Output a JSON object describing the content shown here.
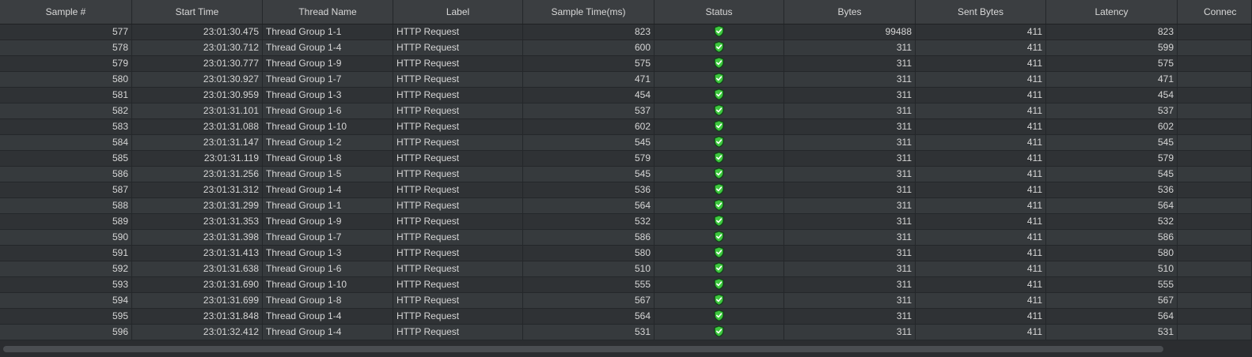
{
  "columns": [
    "Sample #",
    "Start Time",
    "Thread Name",
    "Label",
    "Sample Time(ms)",
    "Status",
    "Bytes",
    "Sent Bytes",
    "Latency",
    "Connec"
  ],
  "rows": [
    {
      "sample": "577",
      "start": "23:01:30.475",
      "thread": "Thread Group 1-1",
      "label": "HTTP Request",
      "time": "823",
      "bytes": "99488",
      "sent": "411",
      "latency": "823"
    },
    {
      "sample": "578",
      "start": "23:01:30.712",
      "thread": "Thread Group 1-4",
      "label": "HTTP Request",
      "time": "600",
      "bytes": "311",
      "sent": "411",
      "latency": "599"
    },
    {
      "sample": "579",
      "start": "23:01:30.777",
      "thread": "Thread Group 1-9",
      "label": "HTTP Request",
      "time": "575",
      "bytes": "311",
      "sent": "411",
      "latency": "575"
    },
    {
      "sample": "580",
      "start": "23:01:30.927",
      "thread": "Thread Group 1-7",
      "label": "HTTP Request",
      "time": "471",
      "bytes": "311",
      "sent": "411",
      "latency": "471"
    },
    {
      "sample": "581",
      "start": "23:01:30.959",
      "thread": "Thread Group 1-3",
      "label": "HTTP Request",
      "time": "454",
      "bytes": "311",
      "sent": "411",
      "latency": "454"
    },
    {
      "sample": "582",
      "start": "23:01:31.101",
      "thread": "Thread Group 1-6",
      "label": "HTTP Request",
      "time": "537",
      "bytes": "311",
      "sent": "411",
      "latency": "537"
    },
    {
      "sample": "583",
      "start": "23:01:31.088",
      "thread": "Thread Group 1-10",
      "label": "HTTP Request",
      "time": "602",
      "bytes": "311",
      "sent": "411",
      "latency": "602"
    },
    {
      "sample": "584",
      "start": "23:01:31.147",
      "thread": "Thread Group 1-2",
      "label": "HTTP Request",
      "time": "545",
      "bytes": "311",
      "sent": "411",
      "latency": "545"
    },
    {
      "sample": "585",
      "start": "23:01:31.119",
      "thread": "Thread Group 1-8",
      "label": "HTTP Request",
      "time": "579",
      "bytes": "311",
      "sent": "411",
      "latency": "579"
    },
    {
      "sample": "586",
      "start": "23:01:31.256",
      "thread": "Thread Group 1-5",
      "label": "HTTP Request",
      "time": "545",
      "bytes": "311",
      "sent": "411",
      "latency": "545"
    },
    {
      "sample": "587",
      "start": "23:01:31.312",
      "thread": "Thread Group 1-4",
      "label": "HTTP Request",
      "time": "536",
      "bytes": "311",
      "sent": "411",
      "latency": "536"
    },
    {
      "sample": "588",
      "start": "23:01:31.299",
      "thread": "Thread Group 1-1",
      "label": "HTTP Request",
      "time": "564",
      "bytes": "311",
      "sent": "411",
      "latency": "564"
    },
    {
      "sample": "589",
      "start": "23:01:31.353",
      "thread": "Thread Group 1-9",
      "label": "HTTP Request",
      "time": "532",
      "bytes": "311",
      "sent": "411",
      "latency": "532"
    },
    {
      "sample": "590",
      "start": "23:01:31.398",
      "thread": "Thread Group 1-7",
      "label": "HTTP Request",
      "time": "586",
      "bytes": "311",
      "sent": "411",
      "latency": "586"
    },
    {
      "sample": "591",
      "start": "23:01:31.413",
      "thread": "Thread Group 1-3",
      "label": "HTTP Request",
      "time": "580",
      "bytes": "311",
      "sent": "411",
      "latency": "580"
    },
    {
      "sample": "592",
      "start": "23:01:31.638",
      "thread": "Thread Group 1-6",
      "label": "HTTP Request",
      "time": "510",
      "bytes": "311",
      "sent": "411",
      "latency": "510"
    },
    {
      "sample": "593",
      "start": "23:01:31.690",
      "thread": "Thread Group 1-10",
      "label": "HTTP Request",
      "time": "555",
      "bytes": "311",
      "sent": "411",
      "latency": "555"
    },
    {
      "sample": "594",
      "start": "23:01:31.699",
      "thread": "Thread Group 1-8",
      "label": "HTTP Request",
      "time": "567",
      "bytes": "311",
      "sent": "411",
      "latency": "567"
    },
    {
      "sample": "595",
      "start": "23:01:31.848",
      "thread": "Thread Group 1-4",
      "label": "HTTP Request",
      "time": "564",
      "bytes": "311",
      "sent": "411",
      "latency": "564"
    },
    {
      "sample": "596",
      "start": "23:01:32.412",
      "thread": "Thread Group 1-4",
      "label": "HTTP Request",
      "time": "531",
      "bytes": "311",
      "sent": "411",
      "latency": "531"
    }
  ],
  "status_icon": "success-shield-check-icon",
  "colors": {
    "background": "#2b2d30",
    "header": "#3b3e41",
    "status_green": "#3ec83e"
  }
}
